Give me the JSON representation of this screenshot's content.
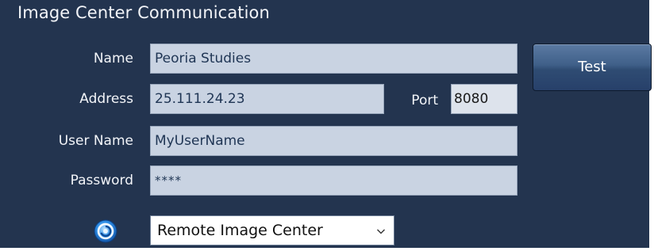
{
  "window": {
    "title": "Image Center Communication"
  },
  "form": {
    "name_label": "Name",
    "name_value": "Peoria Studies",
    "address_label": "Address",
    "address_value": "25.111.24.23",
    "port_label": "Port",
    "port_value": "8080",
    "username_label": "User Name",
    "username_value": "MyUserName",
    "password_label": "Password",
    "password_value": "****"
  },
  "actions": {
    "test_label": "Test"
  },
  "server_type": {
    "icon": "server-swirl-icon",
    "selected": "Remote Image Center"
  },
  "colors": {
    "panel_bg": "#23344f",
    "field_bg": "#c9d3e2",
    "field_text": "#1f3554",
    "button_top": "#5b7aa3",
    "button_bottom": "#27406a",
    "icon_blue": "#2e8ee6"
  }
}
